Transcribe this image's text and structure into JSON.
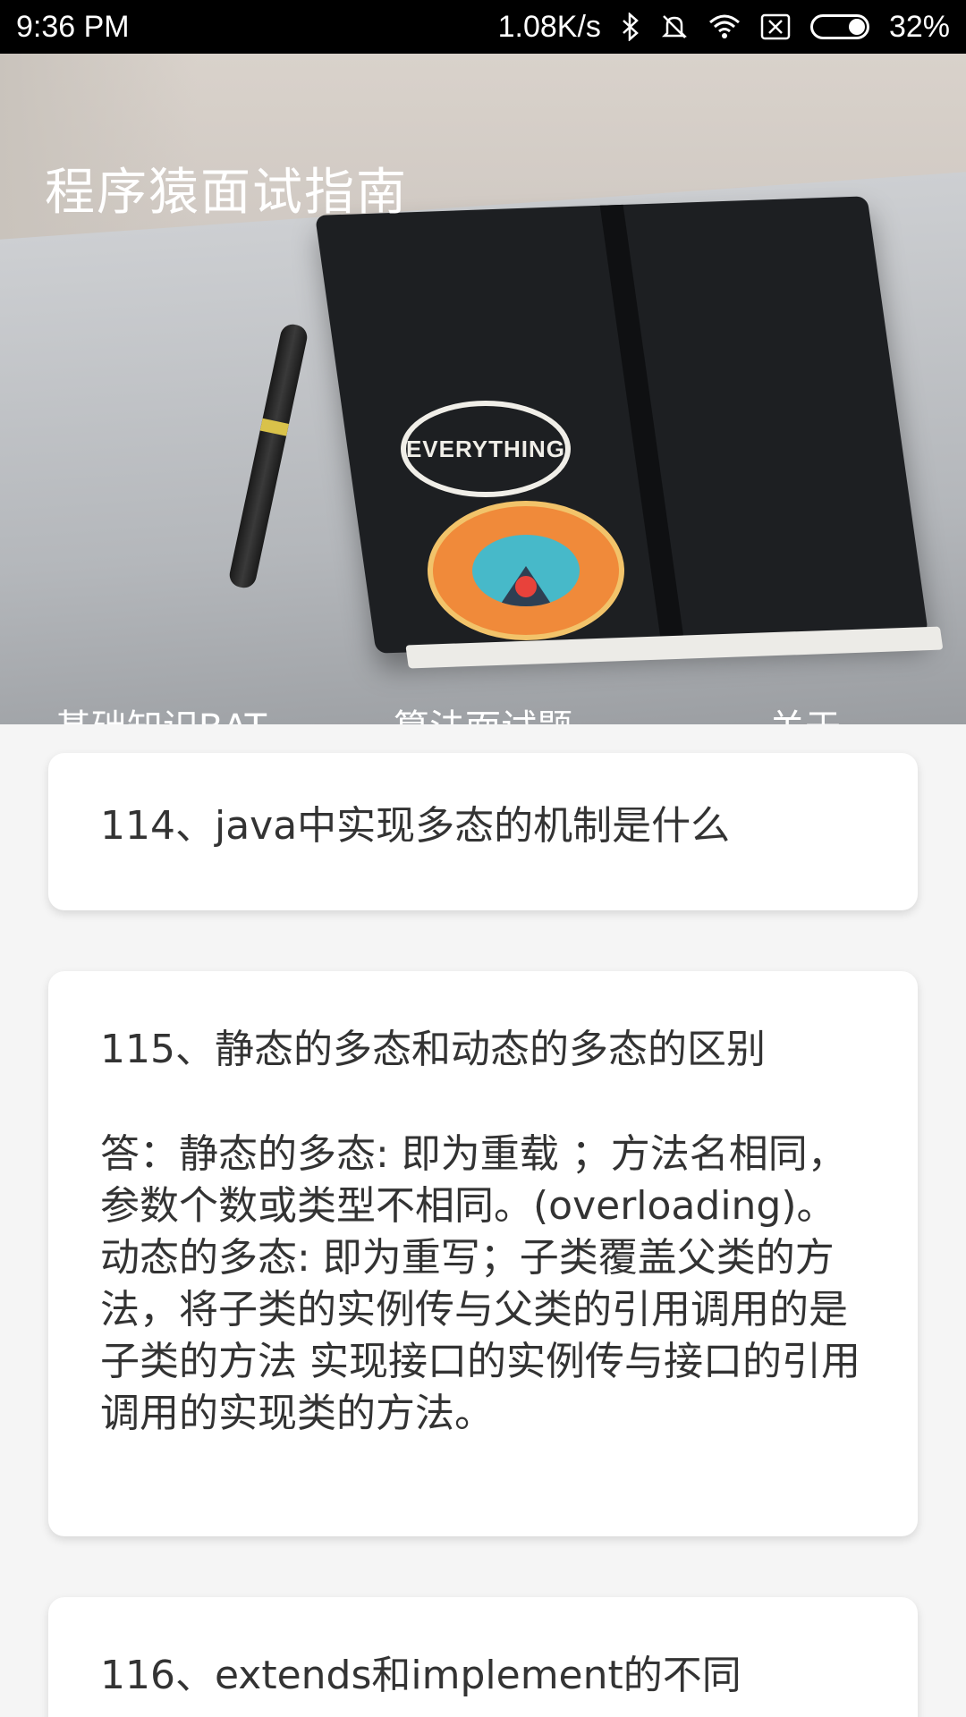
{
  "status_bar": {
    "time": "9:36  PM",
    "network_speed": "1.08K/s",
    "battery_percent": "32%",
    "icons": [
      "bluetooth-icon",
      "silent-icon",
      "wifi-icon",
      "sim-off-icon",
      "battery-icon"
    ],
    "battery_level": 0.32
  },
  "app": {
    "title": "程序猿面试指南"
  },
  "tabs": [
    {
      "label": "基础知识BAT",
      "active": true
    },
    {
      "label": "算法面试题",
      "active": false
    },
    {
      "label": "关于",
      "active": false
    }
  ],
  "header_image": {
    "sticker_text": "EVERYTHING"
  },
  "cards": [
    {
      "title": "114、java中实现多态的机制是什么",
      "answer": ""
    },
    {
      "title": "115、静态的多态和动态的多态的区别",
      "answer": "答：静态的多态: 即为重载 ；方法名相同，参数个数或类型不相同。(overloading)。动态的多态: 即为重写；子类覆盖父类的方法，将子类的实例传与父类的引用调用的是子类的方法 实现接口的实例传与接口的引用调用的实现类的方法。"
    },
    {
      "title": "116、extends和implement的不同",
      "answer": ""
    }
  ],
  "colors": {
    "status_bar": "#000000",
    "tab_indicator": "#ffffff",
    "background": "#f5f5f5",
    "card": "#ffffff",
    "text": "#333333"
  }
}
